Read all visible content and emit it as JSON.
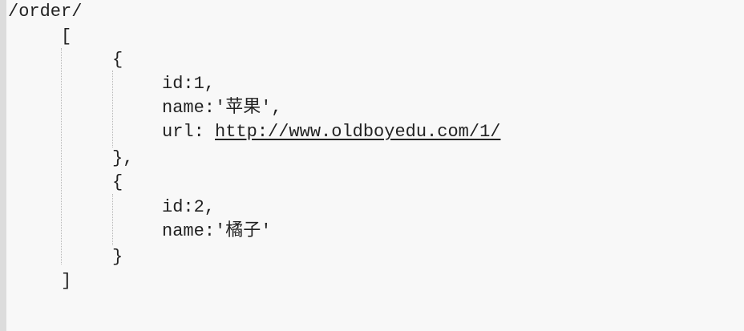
{
  "code": {
    "route": "/order/",
    "open_bracket": "[",
    "close_bracket": "]",
    "items": [
      {
        "open_brace": "{",
        "id_line": "id:1,",
        "name_line": "name:'苹果',",
        "url_label": "url: ",
        "url_value": "http://www.oldboyedu.com/1/",
        "close_brace": "},"
      },
      {
        "open_brace": "{",
        "id_line": "id:2,",
        "name_line": "name:'橘子'",
        "close_brace": "}"
      }
    ]
  }
}
